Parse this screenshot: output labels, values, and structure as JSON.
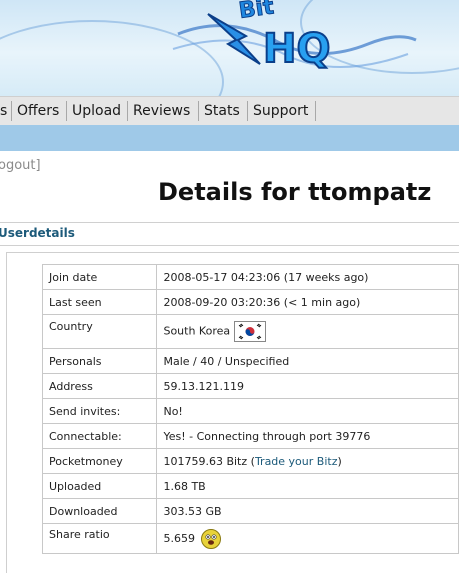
{
  "logo": {
    "text_bit": "Bit",
    "text_hq": "HQ"
  },
  "nav": {
    "items": [
      {
        "label": "s"
      },
      {
        "label": "Offers"
      },
      {
        "label": "Upload"
      },
      {
        "label": "Reviews"
      },
      {
        "label": "Stats"
      },
      {
        "label": "Support"
      }
    ]
  },
  "logout_text": "ogout]",
  "page_title": "Details for ttompatz",
  "section_title": "Userdetails",
  "details": {
    "join_date": {
      "label": "Join date",
      "value": "2008-05-17 04:23:06 (17 weeks ago)"
    },
    "last_seen": {
      "label": "Last seen",
      "value": "2008-09-20 03:20:36 (< 1 min ago)"
    },
    "country": {
      "label": "Country",
      "value": "South Korea",
      "flag": "south-korea-flag-icon"
    },
    "personals": {
      "label": "Personals",
      "value": "Male / 40 / Unspecified"
    },
    "address": {
      "label": "Address",
      "value": "59.13.121.119"
    },
    "send_invites": {
      "label": "Send invites:",
      "value": "No!"
    },
    "connectable": {
      "label": "Connectable:",
      "value": "Yes! - Connecting through port 39776"
    },
    "pocketmoney": {
      "label": "Pocketmoney",
      "value": "101759.63 Bitz (",
      "link": "Trade your Bitz",
      "suffix": ")"
    },
    "uploaded": {
      "label": "Uploaded",
      "value": "1.68 TB"
    },
    "downloaded": {
      "label": "Downloaded",
      "value": "303.53 GB"
    },
    "share_ratio": {
      "label": "Share ratio",
      "value": "5.659",
      "icon": "smiley-icon"
    }
  },
  "colors": {
    "accent": "#1c5a7a",
    "bluebar": "#9fc9e8",
    "nav": "#e6e6e6"
  }
}
